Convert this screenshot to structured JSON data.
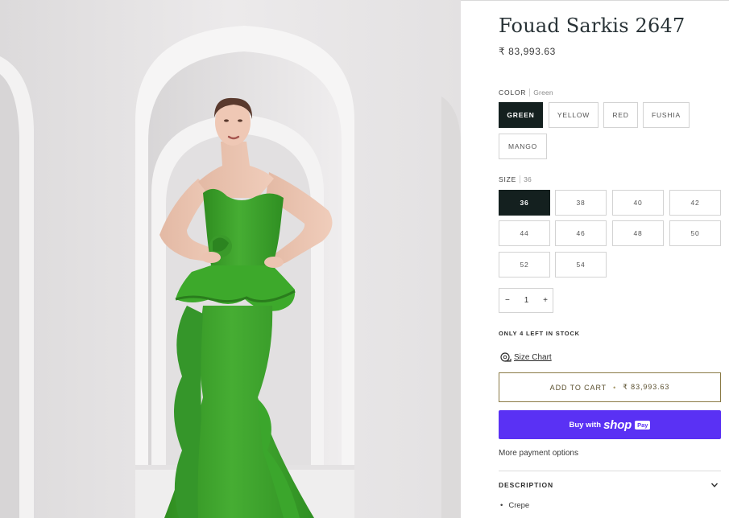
{
  "product": {
    "title": "Fouad Sarkis 2647",
    "price": "₹ 83,993.63"
  },
  "color": {
    "label": "COLOR",
    "selected": "Green",
    "options": [
      "GREEN",
      "YELLOW",
      "RED",
      "FUSHIA",
      "MANGO"
    ],
    "dress_color": "#3fa52d"
  },
  "size": {
    "label": "SIZE",
    "selected": "36",
    "options": [
      "36",
      "38",
      "40",
      "42",
      "44",
      "46",
      "48",
      "50",
      "52",
      "54"
    ]
  },
  "quantity": {
    "minus": "−",
    "value": "1",
    "plus": "+"
  },
  "stock_note": "ONLY 4 LEFT IN STOCK",
  "size_chart": {
    "label": "Size Chart",
    "icon": "measuring-tape-icon"
  },
  "add_to_cart": {
    "label": "ADD TO CART",
    "separator": "•",
    "price": "₹ 83,993.63"
  },
  "shop_pay": {
    "buy_with": "Buy with",
    "brand": "shop",
    "badge": "Pay",
    "color": "#5a31f4"
  },
  "more_payment_options": "More payment options",
  "description": {
    "heading": "DESCRIPTION",
    "icon": "chevron-down-icon",
    "items": [
      "Crepe"
    ]
  }
}
